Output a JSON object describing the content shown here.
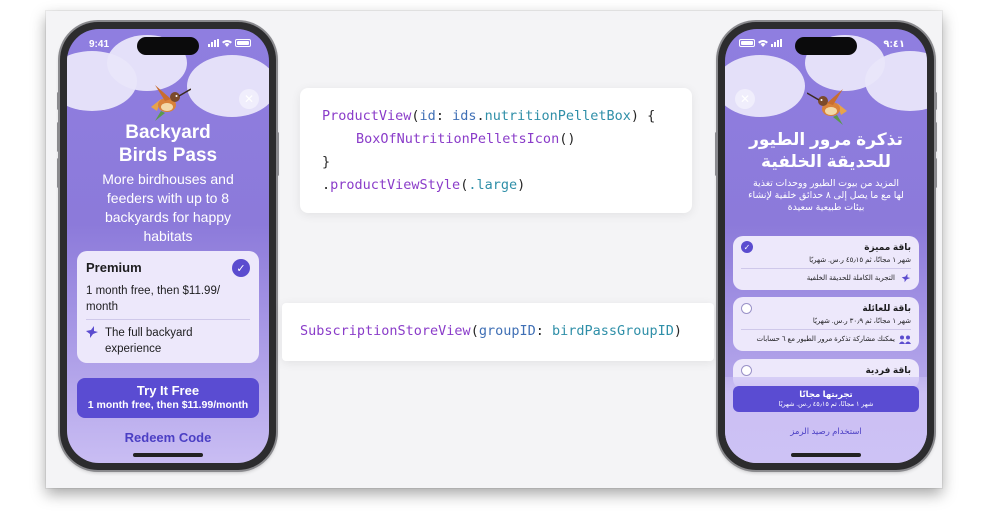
{
  "colors": {
    "accent": "#5a4cd2",
    "screen_purple": "#8c7ada",
    "code_type": "#8a3cc9",
    "code_param": "#3f6fb5",
    "code_property": "#2f8fa8"
  },
  "left_phone": {
    "status_time": "9:41",
    "close_icon": "close-icon",
    "hero_icon": "hummingbird-icon",
    "title_line1": "Backyard",
    "title_line2": "Birds Pass",
    "subtitle_lines": [
      "More birdhouses and",
      "feeders with up to 8",
      "backyards for happy",
      "habitats"
    ],
    "plan": {
      "name": "Premium",
      "price_line1": "1 month free, then $11.99/",
      "price_line2": "month",
      "feature_icon": "bird-icon",
      "feature_line1": "The full backyard",
      "feature_line2": "experience",
      "selected": true
    },
    "cta_label": "Try It Free",
    "cta_sub": "1 month free, then $11.99/month",
    "redeem_label": "Redeem Code"
  },
  "right_phone": {
    "status_time": "٩:٤١",
    "close_icon": "close-icon",
    "hero_icon": "hummingbird-icon",
    "title_line1": "تذكرة مرور الطيور",
    "title_line2": "للحديقة الخلفية",
    "subtitle_lines": [
      "المزيد من بيوت الطيور ووحدات تغذية",
      "لها مع ما يصل إلى ٨ حدائق خلفية لإنشاء",
      "بيئات طبيعية سعيدة"
    ],
    "plans": [
      {
        "name": "باقة مميزة",
        "price": "شهر ١ مجانًا، ثم ٤٥٫١٥ ر.س. شهريًا",
        "feature": "التجربة الكاملة للحديقة الخلفية",
        "feature_icon": "bird-icon",
        "selected": true
      },
      {
        "name": "باقة للعائلة",
        "price": "شهر ١ مجانًا، ثم ٣٠٫٩ ر.س. شهريًا",
        "feature": "يمكنك مشاركة تذكرة مرور الطيور مع ٦ حسابات",
        "feature_icon": "people-icon",
        "selected": false
      },
      {
        "name": "باقة فردية",
        "selected": false
      }
    ],
    "cta_label": "تجربتها مجانًا",
    "cta_sub": "شهر ١ مجانًا، ثم ٤٥٫١٥ ر.س. شهريًا",
    "redeem_label": "استخدام رصيد الرمز"
  },
  "code_product_view": {
    "line1": {
      "type": "ProductView",
      "open": "(",
      "param": "id",
      "colon": ": ",
      "object": "ids",
      "dot": ".",
      "property": "nutritionPelletBox",
      "close": ") {"
    },
    "line2": {
      "type": "BoxOfNutritionPelletsIcon",
      "call": "()"
    },
    "line3": "}",
    "line4": {
      "dot": ".",
      "modifier": "productViewStyle",
      "open": "(",
      "value": ".large",
      "close": ")"
    }
  },
  "code_subscription": {
    "type": "SubscriptionStoreView",
    "open": "(",
    "param": "groupID",
    "colon": ": ",
    "property": "birdPassGroupID",
    "close": ")"
  }
}
